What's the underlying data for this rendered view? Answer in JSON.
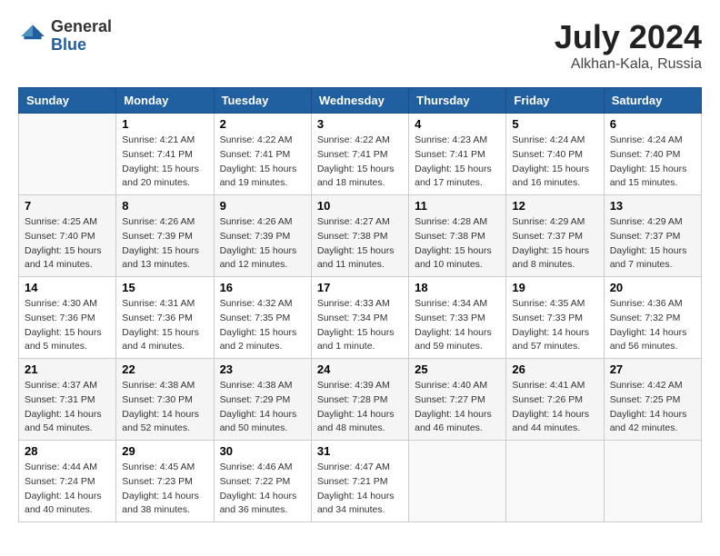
{
  "header": {
    "logo_line1": "General",
    "logo_line2": "Blue",
    "month_year": "July 2024",
    "location": "Alkhan-Kala, Russia"
  },
  "weekdays": [
    "Sunday",
    "Monday",
    "Tuesday",
    "Wednesday",
    "Thursday",
    "Friday",
    "Saturday"
  ],
  "weeks": [
    [
      {
        "day": "",
        "empty": true
      },
      {
        "day": "1",
        "sunrise": "Sunrise: 4:21 AM",
        "sunset": "Sunset: 7:41 PM",
        "daylight": "Daylight: 15 hours and 20 minutes."
      },
      {
        "day": "2",
        "sunrise": "Sunrise: 4:22 AM",
        "sunset": "Sunset: 7:41 PM",
        "daylight": "Daylight: 15 hours and 19 minutes."
      },
      {
        "day": "3",
        "sunrise": "Sunrise: 4:22 AM",
        "sunset": "Sunset: 7:41 PM",
        "daylight": "Daylight: 15 hours and 18 minutes."
      },
      {
        "day": "4",
        "sunrise": "Sunrise: 4:23 AM",
        "sunset": "Sunset: 7:41 PM",
        "daylight": "Daylight: 15 hours and 17 minutes."
      },
      {
        "day": "5",
        "sunrise": "Sunrise: 4:24 AM",
        "sunset": "Sunset: 7:40 PM",
        "daylight": "Daylight: 15 hours and 16 minutes."
      },
      {
        "day": "6",
        "sunrise": "Sunrise: 4:24 AM",
        "sunset": "Sunset: 7:40 PM",
        "daylight": "Daylight: 15 hours and 15 minutes."
      }
    ],
    [
      {
        "day": "7",
        "sunrise": "Sunrise: 4:25 AM",
        "sunset": "Sunset: 7:40 PM",
        "daylight": "Daylight: 15 hours and 14 minutes."
      },
      {
        "day": "8",
        "sunrise": "Sunrise: 4:26 AM",
        "sunset": "Sunset: 7:39 PM",
        "daylight": "Daylight: 15 hours and 13 minutes."
      },
      {
        "day": "9",
        "sunrise": "Sunrise: 4:26 AM",
        "sunset": "Sunset: 7:39 PM",
        "daylight": "Daylight: 15 hours and 12 minutes."
      },
      {
        "day": "10",
        "sunrise": "Sunrise: 4:27 AM",
        "sunset": "Sunset: 7:38 PM",
        "daylight": "Daylight: 15 hours and 11 minutes."
      },
      {
        "day": "11",
        "sunrise": "Sunrise: 4:28 AM",
        "sunset": "Sunset: 7:38 PM",
        "daylight": "Daylight: 15 hours and 10 minutes."
      },
      {
        "day": "12",
        "sunrise": "Sunrise: 4:29 AM",
        "sunset": "Sunset: 7:37 PM",
        "daylight": "Daylight: 15 hours and 8 minutes."
      },
      {
        "day": "13",
        "sunrise": "Sunrise: 4:29 AM",
        "sunset": "Sunset: 7:37 PM",
        "daylight": "Daylight: 15 hours and 7 minutes."
      }
    ],
    [
      {
        "day": "14",
        "sunrise": "Sunrise: 4:30 AM",
        "sunset": "Sunset: 7:36 PM",
        "daylight": "Daylight: 15 hours and 5 minutes."
      },
      {
        "day": "15",
        "sunrise": "Sunrise: 4:31 AM",
        "sunset": "Sunset: 7:36 PM",
        "daylight": "Daylight: 15 hours and 4 minutes."
      },
      {
        "day": "16",
        "sunrise": "Sunrise: 4:32 AM",
        "sunset": "Sunset: 7:35 PM",
        "daylight": "Daylight: 15 hours and 2 minutes."
      },
      {
        "day": "17",
        "sunrise": "Sunrise: 4:33 AM",
        "sunset": "Sunset: 7:34 PM",
        "daylight": "Daylight: 15 hours and 1 minute."
      },
      {
        "day": "18",
        "sunrise": "Sunrise: 4:34 AM",
        "sunset": "Sunset: 7:33 PM",
        "daylight": "Daylight: 14 hours and 59 minutes."
      },
      {
        "day": "19",
        "sunrise": "Sunrise: 4:35 AM",
        "sunset": "Sunset: 7:33 PM",
        "daylight": "Daylight: 14 hours and 57 minutes."
      },
      {
        "day": "20",
        "sunrise": "Sunrise: 4:36 AM",
        "sunset": "Sunset: 7:32 PM",
        "daylight": "Daylight: 14 hours and 56 minutes."
      }
    ],
    [
      {
        "day": "21",
        "sunrise": "Sunrise: 4:37 AM",
        "sunset": "Sunset: 7:31 PM",
        "daylight": "Daylight: 14 hours and 54 minutes."
      },
      {
        "day": "22",
        "sunrise": "Sunrise: 4:38 AM",
        "sunset": "Sunset: 7:30 PM",
        "daylight": "Daylight: 14 hours and 52 minutes."
      },
      {
        "day": "23",
        "sunrise": "Sunrise: 4:38 AM",
        "sunset": "Sunset: 7:29 PM",
        "daylight": "Daylight: 14 hours and 50 minutes."
      },
      {
        "day": "24",
        "sunrise": "Sunrise: 4:39 AM",
        "sunset": "Sunset: 7:28 PM",
        "daylight": "Daylight: 14 hours and 48 minutes."
      },
      {
        "day": "25",
        "sunrise": "Sunrise: 4:40 AM",
        "sunset": "Sunset: 7:27 PM",
        "daylight": "Daylight: 14 hours and 46 minutes."
      },
      {
        "day": "26",
        "sunrise": "Sunrise: 4:41 AM",
        "sunset": "Sunset: 7:26 PM",
        "daylight": "Daylight: 14 hours and 44 minutes."
      },
      {
        "day": "27",
        "sunrise": "Sunrise: 4:42 AM",
        "sunset": "Sunset: 7:25 PM",
        "daylight": "Daylight: 14 hours and 42 minutes."
      }
    ],
    [
      {
        "day": "28",
        "sunrise": "Sunrise: 4:44 AM",
        "sunset": "Sunset: 7:24 PM",
        "daylight": "Daylight: 14 hours and 40 minutes."
      },
      {
        "day": "29",
        "sunrise": "Sunrise: 4:45 AM",
        "sunset": "Sunset: 7:23 PM",
        "daylight": "Daylight: 14 hours and 38 minutes."
      },
      {
        "day": "30",
        "sunrise": "Sunrise: 4:46 AM",
        "sunset": "Sunset: 7:22 PM",
        "daylight": "Daylight: 14 hours and 36 minutes."
      },
      {
        "day": "31",
        "sunrise": "Sunrise: 4:47 AM",
        "sunset": "Sunset: 7:21 PM",
        "daylight": "Daylight: 14 hours and 34 minutes."
      },
      {
        "day": "",
        "empty": true
      },
      {
        "day": "",
        "empty": true
      },
      {
        "day": "",
        "empty": true
      }
    ]
  ]
}
